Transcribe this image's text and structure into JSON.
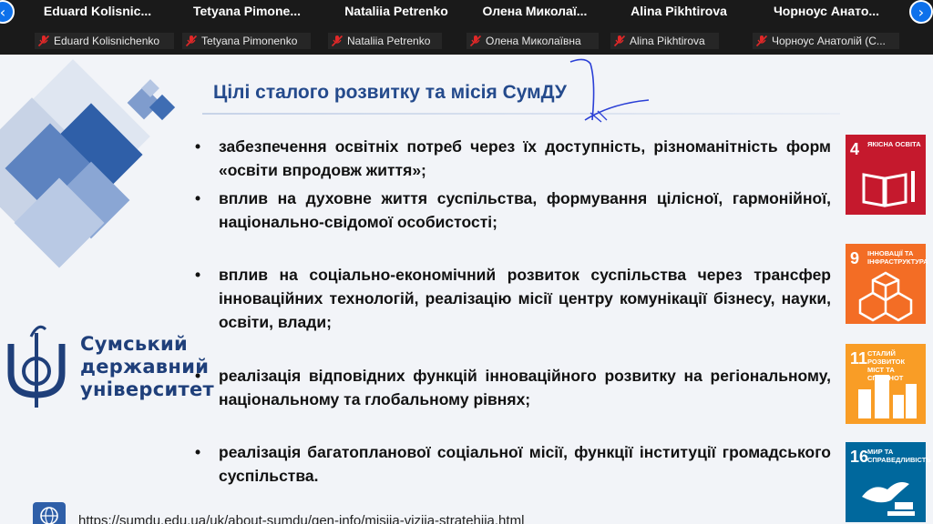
{
  "meeting": {
    "participants": [
      {
        "tile_name": "Eduard Kolisnic...",
        "tag_name": "Eduard Kolisnichenko"
      },
      {
        "tile_name": "Tetyana Pimone...",
        "tag_name": "Tetyana Pimonenko"
      },
      {
        "tile_name": "Nataliia Petrenko",
        "tag_name": "Nataliia Petrenko"
      },
      {
        "tile_name": "Олена Миколаї...",
        "tag_name": "Олена Миколаївна"
      },
      {
        "tile_name": "Alina Pikhtirova",
        "tag_name": "Alina Pikhtirova"
      },
      {
        "tile_name": "Чорноус Анато...",
        "tag_name": "Чорноус Анатолій (С..."
      }
    ],
    "nav_prev_glyph": "‹",
    "nav_next_glyph": "›",
    "mute_icon": "microphone-muted-icon",
    "accent_color": "#0e71eb"
  },
  "slide": {
    "title": "Цілі сталого розвитку та місія СумДУ",
    "bullet_glyph": "•",
    "bullets": [
      "забезпечення освітніх потреб через їх доступність, різноманітність форм «освіти впродовж життя»;",
      "вплив на духовне життя суспільства, формування цілісної, гармонійної, національно-свідомої особистості;",
      "вплив на соціально-економічний розвиток суспільства через трансфер інноваційних технологій, реалізацію місії центру комунікації бізнесу, науки, освіти, влади;",
      "реалізація відповідних функцій інноваційного розвитку на регіональному, національному та глобальному рівнях;",
      "реалізація багатопланової соціальної місії, функції інституції громадського суспільства."
    ],
    "logo": {
      "line1": "Сумський",
      "line2": "державний",
      "line3": "університет"
    },
    "sdg_tiles": [
      {
        "number": "4",
        "label": "ЯКІСНА ОСВІТА",
        "color": "#c5192d",
        "icon": "book-pencil-icon"
      },
      {
        "number": "9",
        "label": "ІННОВАЦІЇ ТА ІНФРАСТРУКТУРА",
        "color": "#f36d25",
        "icon": "cubes-icon"
      },
      {
        "number": "11",
        "label": "СТАЛИЙ РОЗВИТОК МІСТ ТА СПІЛЬНОТ",
        "color": "#f99d26",
        "icon": "city-buildings-icon"
      },
      {
        "number": "16",
        "label": "МИР ТА СПРАВЕДЛИВІСТЬ",
        "color": "#00689d",
        "icon": "dove-gavel-icon"
      }
    ],
    "url": "https://sumdu.edu.ua/uk/about-sumdu/gen-info/misiia-viziia-stratehiia.html",
    "url_icon": "globe-icon",
    "title_color": "#244a8c"
  }
}
